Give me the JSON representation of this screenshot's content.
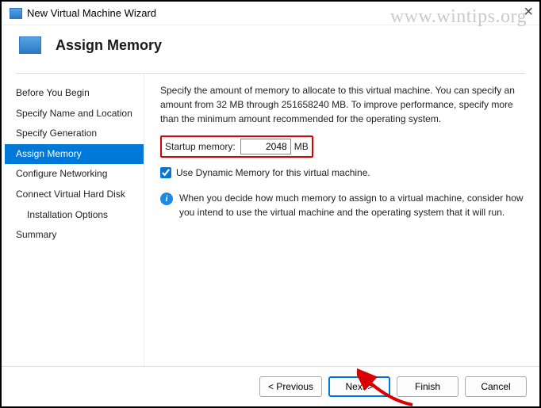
{
  "window": {
    "title": "New Virtual Machine Wizard",
    "watermark": "www.wintips.org"
  },
  "header": {
    "title": "Assign Memory"
  },
  "sidebar": {
    "items": [
      {
        "label": "Before You Begin"
      },
      {
        "label": "Specify Name and Location"
      },
      {
        "label": "Specify Generation"
      },
      {
        "label": "Assign Memory"
      },
      {
        "label": "Configure Networking"
      },
      {
        "label": "Connect Virtual Hard Disk"
      },
      {
        "label": "Installation Options"
      },
      {
        "label": "Summary"
      }
    ]
  },
  "content": {
    "description": "Specify the amount of memory to allocate to this virtual machine. You can specify an amount from 32 MB through 251658240 MB. To improve performance, specify more than the minimum amount recommended for the operating system.",
    "memory_label": "Startup memory:",
    "memory_value": "2048",
    "memory_unit": "MB",
    "dynamic_label": "Use Dynamic Memory for this virtual machine.",
    "info_text": "When you decide how much memory to assign to a virtual machine, consider how you intend to use the virtual machine and the operating system that it will run."
  },
  "footer": {
    "previous": "< Previous",
    "next": "Next >",
    "finish": "Finish",
    "cancel": "Cancel"
  }
}
